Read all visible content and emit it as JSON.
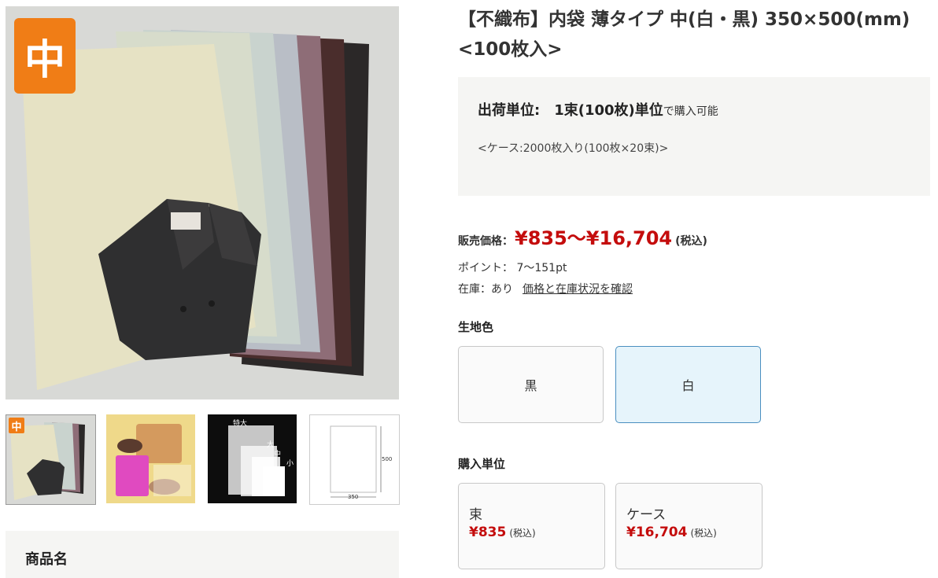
{
  "product": {
    "title_line1": "【不織布】内袋 薄タイプ 中(白・黒) 350×500(mm)",
    "title_line2": "<100枚入>",
    "size_badge": "中"
  },
  "gallery": {
    "thumbnails": [
      {
        "badge": "中"
      },
      {},
      {
        "labels": [
          "特大",
          "大",
          "中",
          "小"
        ]
      },
      {
        "dims": [
          "500",
          "350"
        ]
      }
    ]
  },
  "shipping": {
    "unit_label": "出荷単位:",
    "unit_value": "1束(100枚)単位",
    "unit_suffix": "で購入可能",
    "case_note": "<ケース:2000枚入り(100枚×20束)>"
  },
  "price": {
    "label": "販売価格：",
    "value": "¥835〜¥16,704",
    "tax": "(税込)",
    "points": "ポイント： 7〜151pt",
    "stock": "在庫：あり",
    "stock_link": "価格と在庫状況を確認"
  },
  "fabric_color": {
    "title": "生地色",
    "options": [
      "黒",
      "白"
    ],
    "selected": "白"
  },
  "purchase_unit": {
    "title": "購入単位",
    "options": [
      {
        "name": "束",
        "price": "¥835",
        "tax": "(税込)"
      },
      {
        "name": "ケース",
        "price": "¥16,704",
        "tax": "(税込)"
      }
    ]
  },
  "product_name_section": {
    "label": "商品名"
  },
  "colors": {
    "accent_orange": "#f07d16",
    "price_red": "#c40c0c",
    "selected_bg": "#e6f4fb",
    "selected_border": "#4a8fc0"
  }
}
